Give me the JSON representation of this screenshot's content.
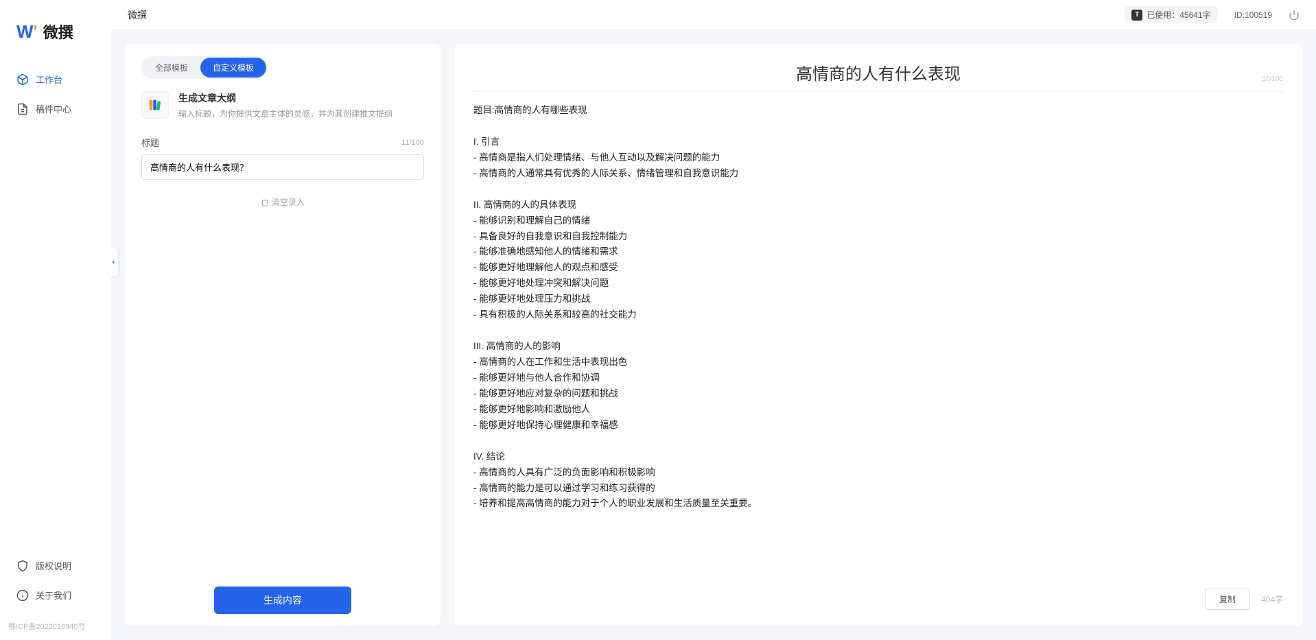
{
  "brand": {
    "logo_text": "微撰"
  },
  "topbar": {
    "title": "微撰",
    "usage_label": "已使用：45641字",
    "user_id": "ID:100519"
  },
  "sidebar": {
    "nav": [
      {
        "label": "工作台",
        "active": true
      },
      {
        "label": "稿件中心",
        "active": false
      }
    ],
    "bottom_nav": [
      {
        "label": "版权说明"
      },
      {
        "label": "关于我们"
      }
    ],
    "footer": "鄂ICP备2022016946号"
  },
  "left_panel": {
    "tabs": [
      {
        "label": "全部模板",
        "active": false
      },
      {
        "label": "自定义模板",
        "active": true
      }
    ],
    "template": {
      "title": "生成文章大纲",
      "desc": "输入标题，为你提供文章主体的灵感，并为其创建推文提纲"
    },
    "form": {
      "title_label": "标题",
      "title_value": "高情商的人有什么表现？",
      "title_count": "11/100"
    },
    "clear_label": "清空录入",
    "generate_label": "生成内容"
  },
  "right_panel": {
    "title": "高情商的人有什么表现",
    "title_count": "10/100",
    "body": "题目:高情商的人有哪些表现\n\nI. 引言\n- 高情商是指人们处理情绪、与他人互动以及解决问题的能力\n- 高情商的人通常具有优秀的人际关系、情绪管理和自我意识能力\n\nII. 高情商的人的具体表现\n- 能够识别和理解自己的情绪\n- 具备良好的自我意识和自我控制能力\n- 能够准确地感知他人的情绪和需求\n- 能够更好地理解他人的观点和感受\n- 能够更好地处理冲突和解决问题\n- 能够更好地处理压力和挑战\n- 具有积极的人际关系和较高的社交能力\n\nIII. 高情商的人的影响\n- 高情商的人在工作和生活中表现出色\n- 能够更好地与他人合作和协调\n- 能够更好地应对复杂的问题和挑战\n- 能够更好地影响和激励他人\n- 能够更好地保持心理健康和幸福感\n\nIV. 结论\n- 高情商的人具有广泛的负面影响和积极影响\n- 高情商的能力是可以通过学习和练习获得的\n- 培养和提高高情商的能力对于个人的职业发展和生活质量至关重要。",
    "copy_label": "复制",
    "word_count": "404字"
  }
}
